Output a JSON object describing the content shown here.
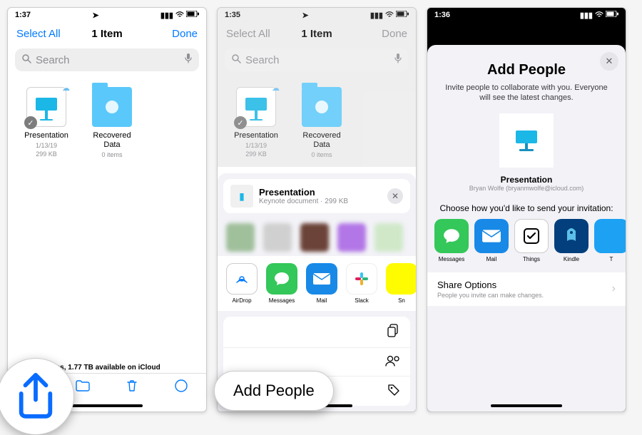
{
  "panel1": {
    "time": "1:37",
    "nav": {
      "left": "Select All",
      "center": "1 Item",
      "right": "Done"
    },
    "search_placeholder": "Search",
    "items": [
      {
        "name": "Presentation",
        "date": "1/13/19",
        "size": "299 KB"
      },
      {
        "name": "Recovered Data",
        "meta": "0 items"
      }
    ],
    "footer": "ms, 1.77 TB available on iCloud"
  },
  "panel2": {
    "time": "1:35",
    "nav": {
      "left": "Select All",
      "center": "1 Item",
      "right": "Done"
    },
    "search_placeholder": "Search",
    "items": [
      {
        "name": "Presentation",
        "date": "1/13/19",
        "size": "299 KB"
      },
      {
        "name": "Recovered Data",
        "meta": "0 items"
      }
    ],
    "share": {
      "title": "Presentation",
      "subtitle": "Keynote document · 299 KB",
      "apps": [
        {
          "label": "AirDrop"
        },
        {
          "label": "Messages"
        },
        {
          "label": "Mail"
        },
        {
          "label": "Slack"
        },
        {
          "label": "Sn"
        }
      ],
      "actions": [
        "",
        "",
        ""
      ]
    }
  },
  "panel3": {
    "time": "1:36",
    "title": "Add People",
    "desc": "Invite people to collaborate with you. Everyone will see the latest changes.",
    "doc": {
      "name": "Presentation",
      "owner": "Bryan Wolfe (bryanmwolfe@icloud.com)"
    },
    "prompt": "Choose how you'd like to send your invitation:",
    "apps": [
      "Messages",
      "Mail",
      "Things",
      "Kindle",
      "T"
    ],
    "share_options": {
      "title": "Share Options",
      "sub": "People you invite can make changes."
    }
  },
  "callouts": {
    "pill": "Add People"
  }
}
